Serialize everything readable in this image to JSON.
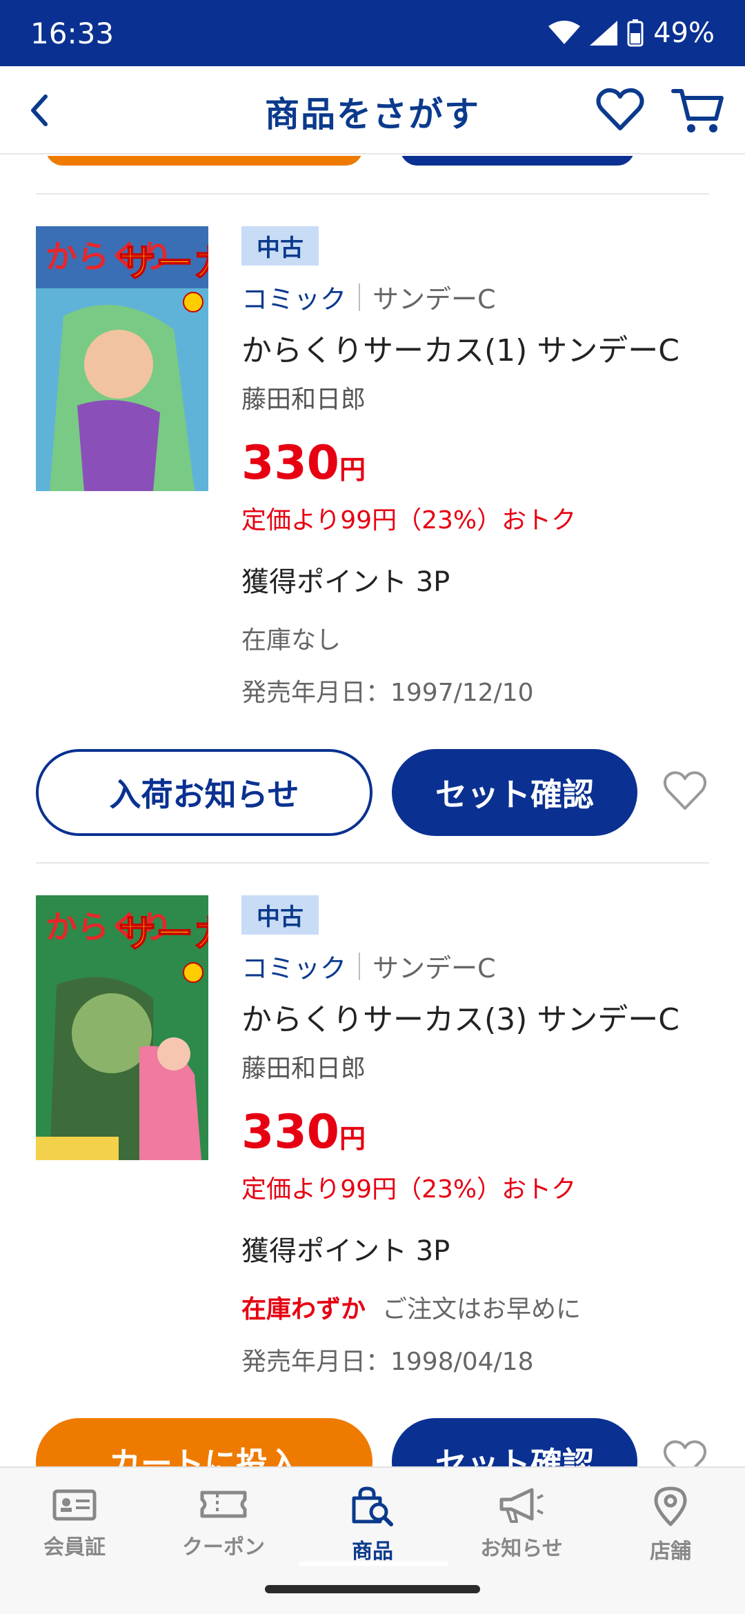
{
  "status": {
    "time": "16:33",
    "battery": "49%"
  },
  "header": {
    "title": "商品をさがす"
  },
  "items": [
    {
      "badge": "中古",
      "category": "コミック",
      "subcategory": "サンデーC",
      "title": "からくりサーカス(1) サンデーC",
      "author": "藤田和日郎",
      "price": "330",
      "currency": "円",
      "discount": "定価より99円（23%）おトク",
      "points": "獲得ポイント 3P",
      "stock": "在庫なし",
      "release": "発売年月日：1997/12/10",
      "primary_button": "入荷お知らせ",
      "secondary_button": "セット確認"
    },
    {
      "badge": "中古",
      "category": "コミック",
      "subcategory": "サンデーC",
      "title": "からくりサーカス(3) サンデーC",
      "author": "藤田和日郎",
      "price": "330",
      "currency": "円",
      "discount": "定価より99円（23%）おトク",
      "points": "獲得ポイント 3P",
      "stock_label": "在庫わずか",
      "stock_note": "ご注文はお早めに",
      "release": "発売年月日：1998/04/18",
      "primary_button": "カートに投入",
      "secondary_button": "セット確認"
    }
  ],
  "nav": [
    {
      "label": "会員証",
      "icon": "member-card-icon"
    },
    {
      "label": "クーポン",
      "icon": "coupon-icon"
    },
    {
      "label": "商品",
      "icon": "shopping-search-icon"
    },
    {
      "label": "お知らせ",
      "icon": "megaphone-icon"
    },
    {
      "label": "店舗",
      "icon": "location-pin-icon"
    }
  ],
  "colors": {
    "brand": "#0a3191",
    "accent": "#ef7a00",
    "price": "#e60012"
  }
}
